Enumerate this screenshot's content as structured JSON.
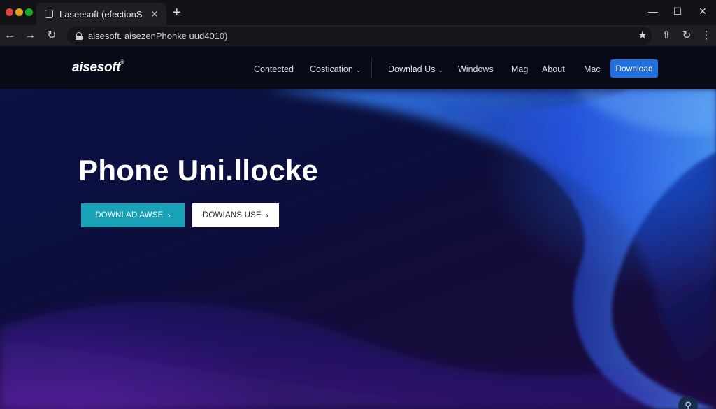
{
  "browser": {
    "tab_title": "Laseesoft (efectionS",
    "tab_close": "✕",
    "new_tab": "+",
    "url": "aisesoft. aisezenPhonke uud4010)",
    "controls": {
      "minimize": "—",
      "maximize": "☐",
      "close": "✕"
    },
    "nav": {
      "back": "←",
      "forward": "→",
      "reload": "↻"
    },
    "toolbar_icons": {
      "bookmark": "★",
      "share": "⇧",
      "refresh": "↻",
      "menu": "⋮"
    },
    "traffic_colors": [
      "#e0443e",
      "#dea123",
      "#1aab29"
    ]
  },
  "site": {
    "logo": "aisesoft",
    "logo_mark": "®",
    "nav": [
      {
        "label": "Contected",
        "has_dropdown": false
      },
      {
        "label": "Costication",
        "has_dropdown": true
      },
      {
        "label": "Downlad Us",
        "has_dropdown": true
      },
      {
        "label": "Windows",
        "has_dropdown": false
      },
      {
        "label": "Mag",
        "has_dropdown": false
      },
      {
        "label": "About",
        "has_dropdown": false
      },
      {
        "label": "Mac",
        "has_dropdown": false
      }
    ],
    "download_button": "Download",
    "accent_color": "#1f6fe0"
  },
  "hero": {
    "title": "Phone Uni.llocke",
    "primary_button": "DOWNLAD AWSE",
    "secondary_button": "DOWIANS USE",
    "chevron": "›",
    "corner_icon": "⚲",
    "primary_color": "#18a2b8"
  }
}
